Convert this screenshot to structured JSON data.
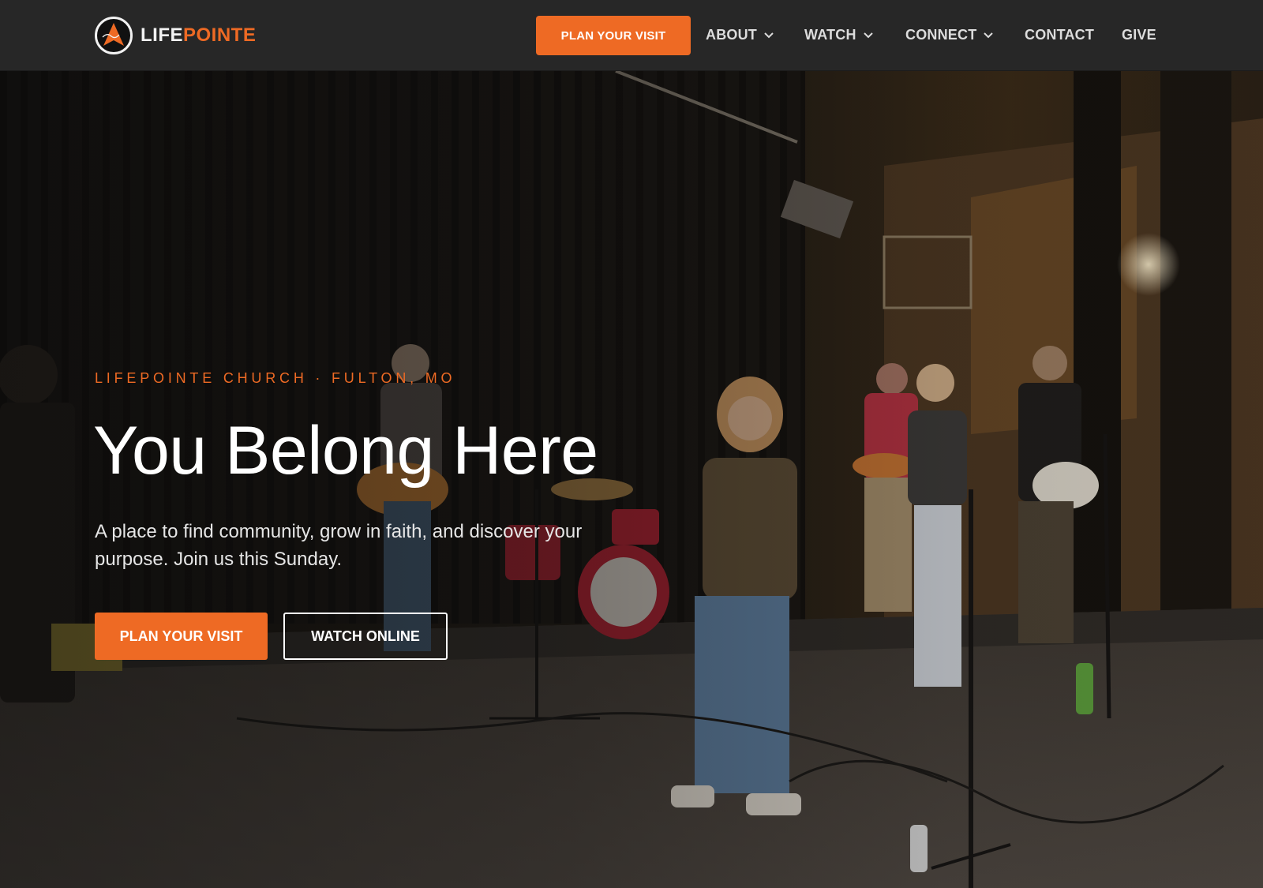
{
  "brand": {
    "name_part1": "LIFE",
    "name_part2": "POINTE",
    "logo_icon": "lifepointe-logo-icon",
    "accent_color": "#ee6a24"
  },
  "nav": {
    "cta_label": "PLAN YOUR VISIT",
    "items": [
      {
        "label": "ABOUT",
        "has_dropdown": true
      },
      {
        "label": "WATCH",
        "has_dropdown": true
      },
      {
        "label": "CONNECT",
        "has_dropdown": true
      },
      {
        "label": "CONTACT",
        "has_dropdown": false
      },
      {
        "label": "GIVE",
        "has_dropdown": false
      }
    ]
  },
  "hero": {
    "eyebrow": "LIFEPOINTE CHURCH · FULTON, MO",
    "headline": "You Belong Here",
    "subtext": "A place to find community, grow in faith, and discover your purpose. Join us this Sunday.",
    "primary_button": "PLAN YOUR VISIT",
    "secondary_button": "WATCH ONLINE",
    "background_image": "worship-band-on-stage-photo"
  }
}
